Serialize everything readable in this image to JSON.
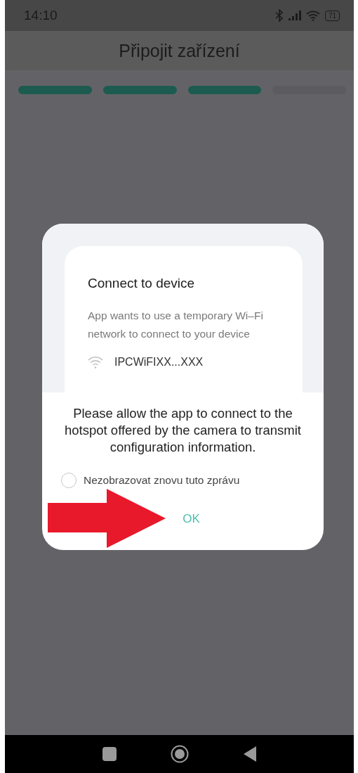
{
  "status_bar": {
    "time": "14:10",
    "battery": "71"
  },
  "header": {
    "title": "Připojit zařízení"
  },
  "progress_steps": [
    {
      "done": true
    },
    {
      "done": true
    },
    {
      "done": true
    },
    {
      "done": false
    }
  ],
  "dialog": {
    "preview": {
      "title": "Connect to device",
      "text": "App wants to use a temporary Wi–Fi network to connect to your device",
      "network": "IPCWiFIXX...XXX"
    },
    "message": "Please allow the app to connect to the hotspot offered by the camera to transmit configuration information.",
    "dont_show_again": {
      "label": "Nezobrazovat znovu tuto zprávu",
      "checked": false
    },
    "button": "OK"
  }
}
